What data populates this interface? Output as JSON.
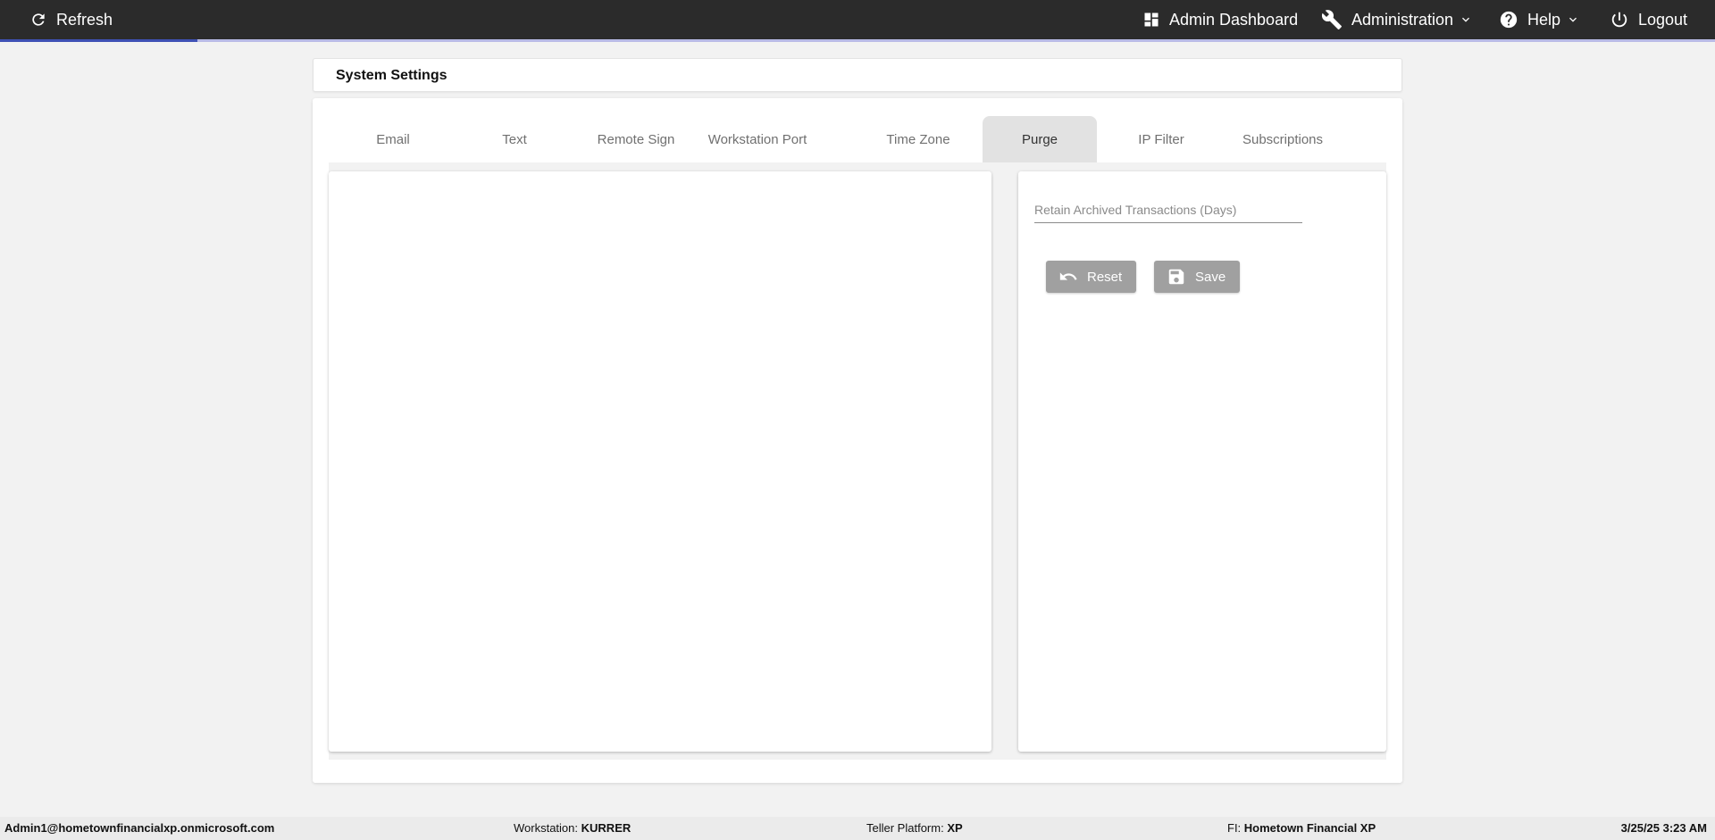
{
  "topbar": {
    "refresh_label": "Refresh",
    "admin_dashboard_label": "Admin Dashboard",
    "administration_label": "Administration",
    "help_label": "Help",
    "logout_label": "Logout",
    "progress_percent": 11.5,
    "background_color": "#2b2b2b",
    "accent_color": "#3f51b5"
  },
  "header": {
    "title": "System Settings"
  },
  "tabs": [
    {
      "label": "Email"
    },
    {
      "label": "Text"
    },
    {
      "label": "Remote Sign"
    },
    {
      "label": "Workstation Port"
    },
    {
      "label": "Time Zone"
    },
    {
      "label": "Purge",
      "active": true
    },
    {
      "label": "IP Filter"
    },
    {
      "label": "Subscriptions"
    }
  ],
  "purge": {
    "retain_label": "Retain Archived Transactions (Days)",
    "retain_value": "",
    "reset_label": "Reset",
    "save_label": "Save",
    "button_color": "#a0a0a0"
  },
  "icons": {
    "refresh": "refresh-icon",
    "dashboard": "dashboard-icon",
    "administration": "wrench-icon",
    "help": "help-circle-icon",
    "logout": "power-icon",
    "reset": "undo-icon",
    "save": "floppy-disk-icon"
  },
  "status": {
    "user": "Admin1@hometownfinancialxp.onmicrosoft.com",
    "workstation_label": "Workstation:",
    "workstation_value": "KURRER",
    "platform_label": "Teller Platform:",
    "platform_value": "XP",
    "fi_label": "FI:",
    "fi_value": "Hometown Financial XP",
    "datetime": "3/25/25 3:23 AM"
  }
}
